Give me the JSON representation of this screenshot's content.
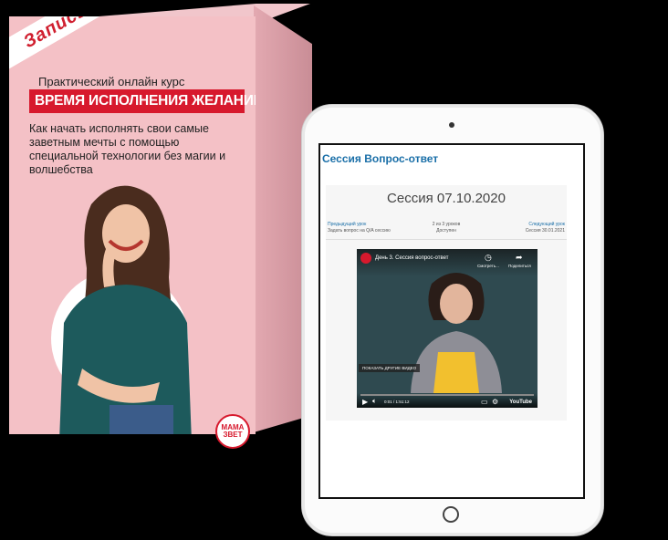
{
  "box": {
    "badge": "Запись",
    "subtitle": "Практический онлайн курс",
    "title": "ВРЕМЯ ИСПОЛНЕНИЯ ЖЕЛАНИЙ",
    "description": "Как начать исполнять свои самые заветным мечты с помощью специальной технологии без магии и волшебства",
    "logo_line1": "МАМА",
    "logo_line2": "ЗВЕТ"
  },
  "tablet": {
    "page_title": "Сессия Вопрос-ответ",
    "session_heading": "Сессия 07.10.2020",
    "nav": {
      "prev_label": "Предыдущий урок",
      "prev_text": "Задать вопрос на Q/A сессию",
      "center_label": "2 из 3 уроков",
      "center_text": "Доступен",
      "next_label": "Следующий урок",
      "next_text": "Сессия 30.01.2021"
    },
    "video": {
      "title": "День 3. Сессия вопрос-ответ",
      "watch_later_label": "Смотреть...",
      "share_label": "Поделиться",
      "more_videos_button": "ПОКАЗАТЬ ДРУГИЕ ВИДЕО",
      "time": "0:01 / 1:51:12",
      "youtube_label": "YouTube"
    }
  },
  "colors": {
    "box_pink": "#f4c1c6",
    "title_red": "#d7192d",
    "link_blue": "#1a6fa8"
  }
}
